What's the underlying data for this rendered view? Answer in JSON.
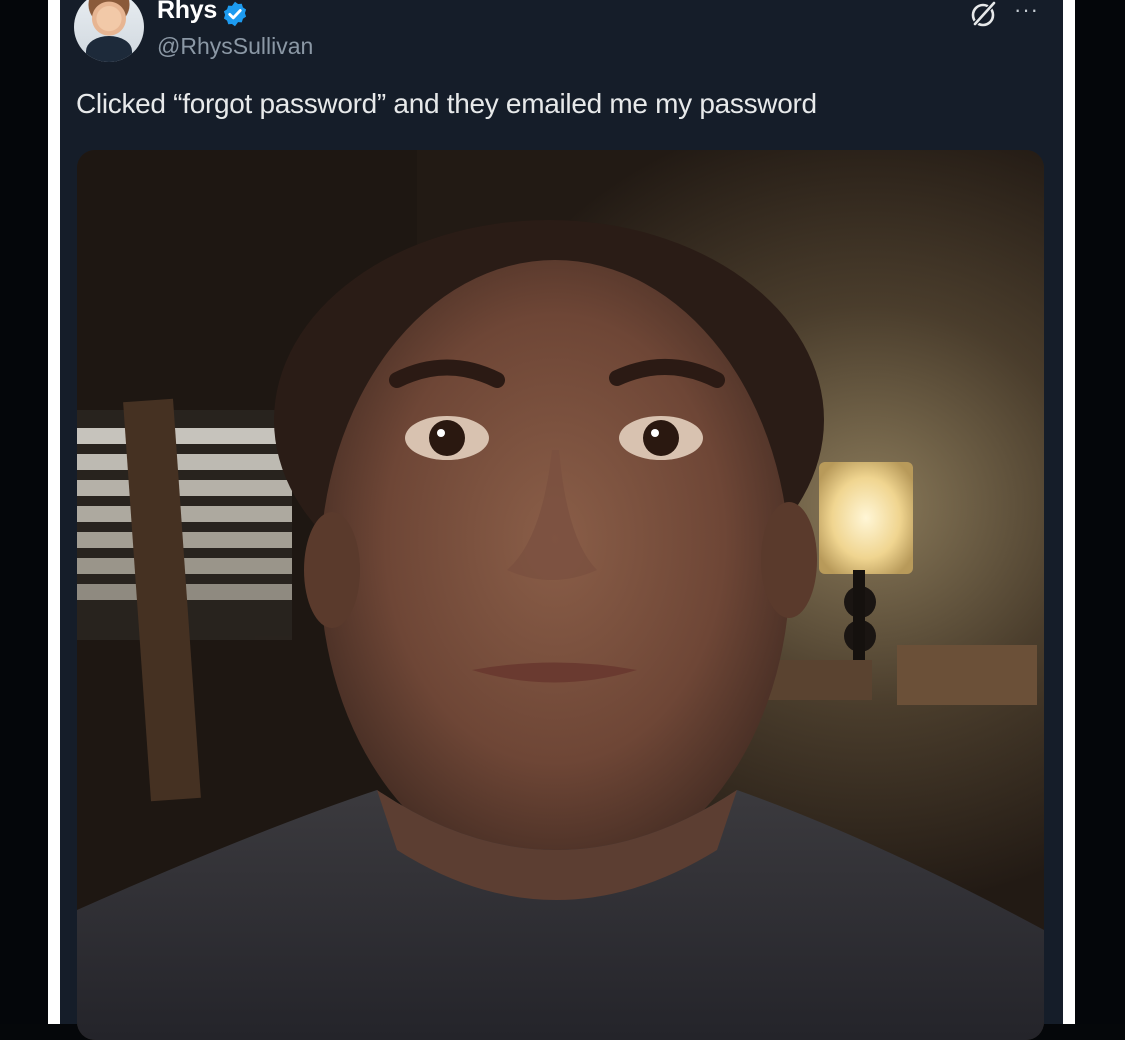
{
  "tweet": {
    "author_name": "Rhys",
    "author_handle": "@RhysSullivan",
    "text": "Clicked “forgot password” and they emailed me my password",
    "verified": true
  },
  "icons": {
    "verified": "verified-badge-icon",
    "grok": "grok-icon",
    "more": "more-options-icon"
  },
  "colors": {
    "background": "#151d29",
    "verified_blue": "#1d9bf0",
    "text_primary": "#e7e9ea",
    "text_secondary": "#8b98a5"
  }
}
